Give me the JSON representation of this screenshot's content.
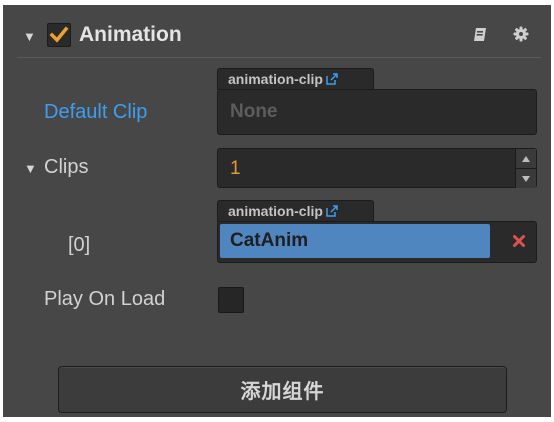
{
  "component": {
    "title": "Animation",
    "enabled": true,
    "header_icons": [
      "book-icon",
      "gear-icon"
    ]
  },
  "properties": {
    "default_clip": {
      "label": "Default Clip",
      "type_tag": "animation-clip",
      "value": "None"
    },
    "clips": {
      "label": "Clips",
      "count": "1",
      "items": [
        {
          "index_label": "[0]",
          "type_tag": "animation-clip",
          "value": "CatAnim"
        }
      ]
    },
    "play_on_load": {
      "label": "Play On Load",
      "checked": false
    }
  },
  "add_component_button": {
    "label": "添加组件"
  },
  "colors": {
    "panel_bg": "#474747",
    "accent_orange": "#f0a030",
    "link_blue": "#3d9ef0",
    "asset_selected": "#4f86c0",
    "clear_red": "#d9534f",
    "number_orange": "#e09a3e"
  }
}
